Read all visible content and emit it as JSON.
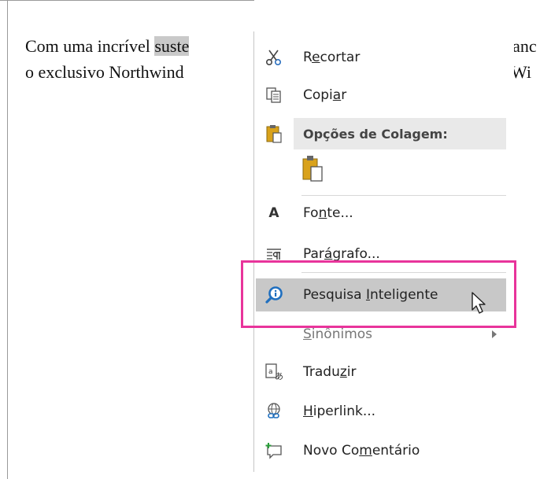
{
  "document": {
    "line1_before": "Com uma incrível ",
    "line1_selected": "suste",
    "line1_after": "lanc",
    "line2_before": "o exclusivo Northwind",
    "line2_after": "Wi"
  },
  "menu": {
    "cut": {
      "label_pre": "R",
      "label_u": "e",
      "label_post": "cortar"
    },
    "copy": {
      "label_pre": "Copi",
      "label_u": "a",
      "label_post": "r"
    },
    "paste_header": "Opções de Colagem:",
    "font": {
      "label_pre": "Fo",
      "label_u": "n",
      "label_post": "te..."
    },
    "paragraph": {
      "label_pre": "Par",
      "label_u": "á",
      "label_post": "grafo..."
    },
    "smart_lookup": {
      "label_pre": "Pesquisa ",
      "label_u": "I",
      "label_post": "nteligente"
    },
    "synonyms": {
      "label_pre": "",
      "label_u": "S",
      "label_post": "inônimos"
    },
    "translate": {
      "label_pre": "Tradu",
      "label_u": "z",
      "label_post": "ir"
    },
    "hyperlink": {
      "label_pre": "",
      "label_u": "H",
      "label_post": "iperlink..."
    },
    "new_comment": {
      "label_pre": "Novo Co",
      "label_u": "m",
      "label_post": "entário"
    }
  },
  "colors": {
    "highlight_box": "#e8349b",
    "hover_bg": "#c8c8c8",
    "smart_lookup_icon": "#1f6fbf"
  },
  "icons": [
    "scissors-icon",
    "copy-icon",
    "clipboard-icon",
    "paste-keep-format-icon",
    "font-icon",
    "paragraph-icon",
    "smart-lookup-icon",
    "translate-icon",
    "hyperlink-icon",
    "new-comment-icon",
    "submenu-arrow-icon",
    "mouse-cursor-icon"
  ]
}
